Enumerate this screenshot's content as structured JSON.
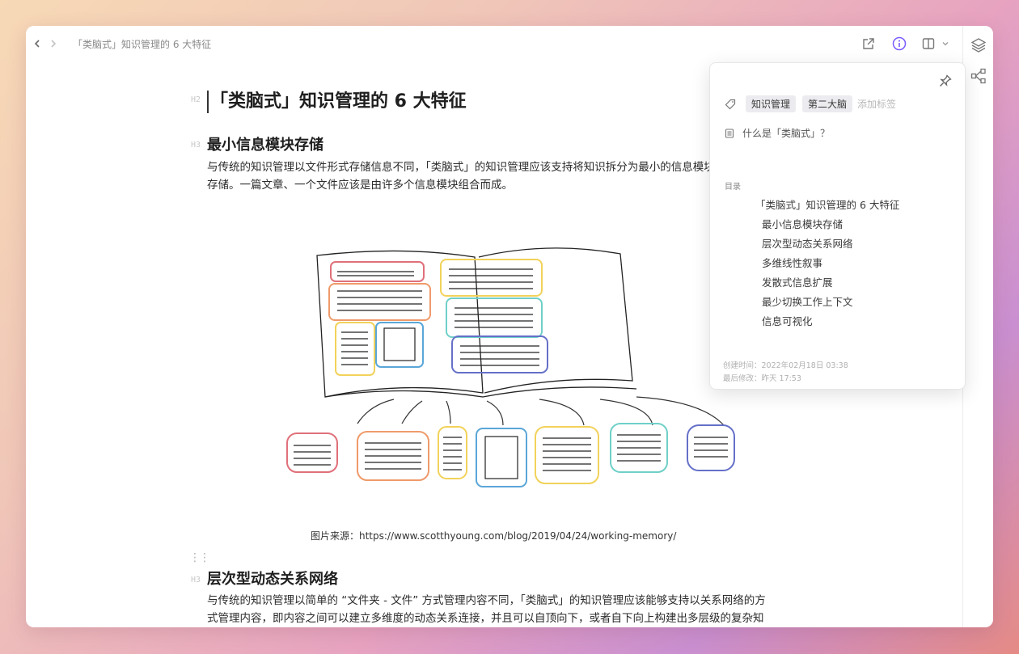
{
  "topbar": {
    "title": "「类脑式」知识管理的 6 大特征"
  },
  "document": {
    "h2_mark": "H2",
    "h3_mark": "H3",
    "title": "「类脑式」知识管理的 6 大特征",
    "sections": [
      {
        "heading": "最小信息模块存储",
        "paragraph": "与传统的知识管理以文件形式存储信息不同，「类脑式」的知识管理应该支持将知识拆分为最小的信息模块存储。一篇文章、一个文件应该是由许多个信息模块组合而成。"
      },
      {
        "heading": "层次型动态关系网络",
        "paragraph": "与传统的知识管理以简单的 “文件夹 - 文件” 方式管理内容不同，「类脑式」的知识管理应该能够支持以关系网络的方式管理内容，即内容之间可以建立多维度的动态关系连接，并且可以自顶向下，或者自下向上构建出多层级的复杂知识网络。"
      }
    ],
    "image_caption": "图片来源：https://www.scotthyoung.com/blog/2019/04/24/working-memory/"
  },
  "panel": {
    "tags": [
      "知识管理",
      "第二大脑"
    ],
    "add_tag_placeholder": "添加标签",
    "summary": "什么是「类脑式」？",
    "toc_label": "目录",
    "toc": [
      {
        "label": "「类脑式」知识管理的 6 大特征",
        "level": 1
      },
      {
        "label": "最小信息模块存储",
        "level": 2
      },
      {
        "label": "层次型动态关系网络",
        "level": 2
      },
      {
        "label": "多维线性叙事",
        "level": 2
      },
      {
        "label": "发散式信息扩展",
        "level": 2
      },
      {
        "label": "最少切换工作上下文",
        "level": 2
      },
      {
        "label": "信息可视化",
        "level": 2
      }
    ],
    "created": "创建时间：2022年02月18日 03:38",
    "modified": "最后修改：昨天 17:53"
  },
  "colors": {
    "accent": "#7b5cff",
    "sketch_red": "#e0707a",
    "sketch_orange": "#ef9a6a",
    "sketch_yellow": "#f2d25a",
    "sketch_blue": "#5aa6d8",
    "sketch_teal": "#6fd0c8",
    "sketch_indigo": "#6570c8"
  }
}
